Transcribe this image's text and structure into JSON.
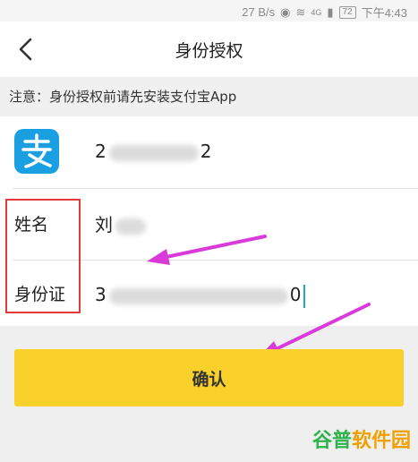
{
  "status_bar": {
    "network_speed": "27 B/s",
    "signal_tag": "4G",
    "battery": "72",
    "time": "下午4:43"
  },
  "header": {
    "title": "身份授权"
  },
  "notice": {
    "text": "注意：身份授权前请先安装支付宝App"
  },
  "form": {
    "account_prefix": "2",
    "account_suffix": "2",
    "name_label": "姓名",
    "name_prefix": "刘",
    "id_label": "身份证",
    "id_prefix": "3",
    "id_suffix": "0"
  },
  "actions": {
    "confirm_label": "确认"
  },
  "watermark": {
    "part1": "谷普",
    "part2": "软件园"
  },
  "colors": {
    "alipay_blue": "#1a9fe3",
    "confirm_yellow": "#f9d12a",
    "highlight_red": "#e23a3a",
    "arrow_magenta": "#d93ad9"
  }
}
